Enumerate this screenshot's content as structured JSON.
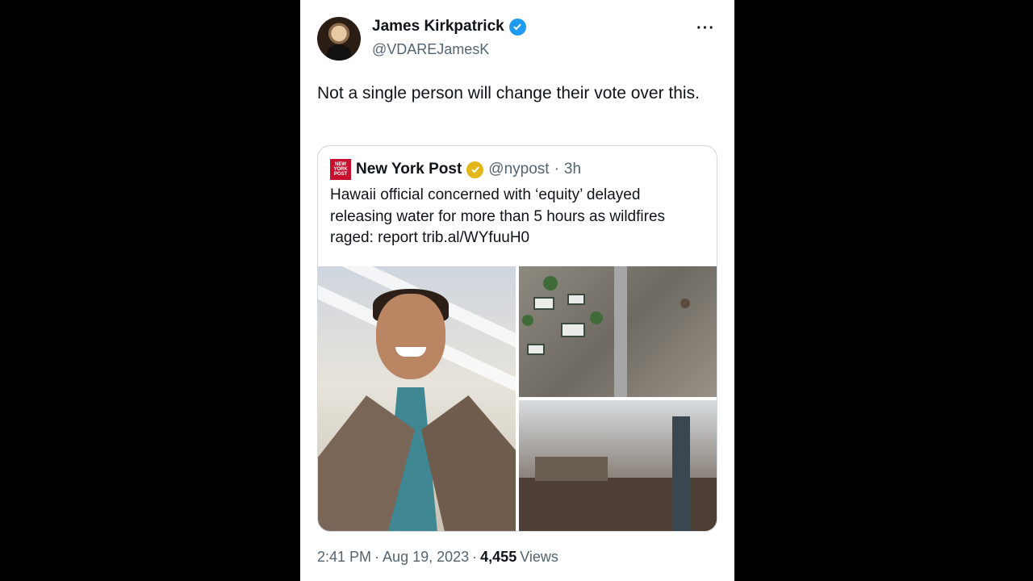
{
  "author": {
    "name": "James Kirkpatrick",
    "handle": "@VDAREJamesK"
  },
  "more_icon": "···",
  "tweet": {
    "text": "Not a single person will change their vote over this."
  },
  "quoted": {
    "logo_text": "NEW YORK POST",
    "name": "New York Post",
    "handle": "@nypost",
    "separator": "·",
    "age": "3h",
    "text": "Hawaii official concerned with ‘equity’ delayed releasing water for more than 5 hours as wildfires raged: report trib.al/WYfuuH0"
  },
  "footer": {
    "time": "2:41 PM",
    "dot1": "·",
    "date": "Aug 19, 2023",
    "dot2": "·",
    "views_count": "4,455",
    "views_label": "Views"
  },
  "colors": {
    "verified_blue": "#1d9bf0",
    "verified_gold": "#e2b719",
    "nypost_red": "#c8102e"
  }
}
